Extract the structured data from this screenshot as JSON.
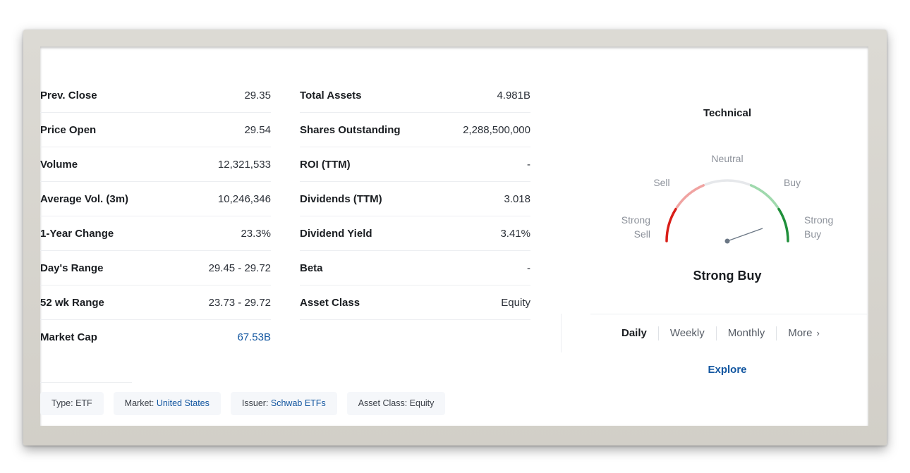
{
  "left_stats": [
    {
      "label": "Prev. Close",
      "value": "29.35"
    },
    {
      "label": "Price Open",
      "value": "29.54"
    },
    {
      "label": "Volume",
      "value": "12,321,533"
    },
    {
      "label": "Average Vol. (3m)",
      "value": "10,246,346"
    },
    {
      "label": "1-Year Change",
      "value": "23.3%"
    },
    {
      "label": "Day's Range",
      "value": "29.45 - 29.72"
    },
    {
      "label": "52 wk Range",
      "value": "23.73 - 29.72"
    },
    {
      "label": "Market Cap",
      "value": "67.53B"
    }
  ],
  "mid_stats": [
    {
      "label": "Total Assets",
      "value": "4.981B"
    },
    {
      "label": "Shares Outstanding",
      "value": "2,288,500,000"
    },
    {
      "label": "ROI (TTM)",
      "value": "-"
    },
    {
      "label": "Dividends (TTM)",
      "value": "3.018"
    },
    {
      "label": "Dividend Yield",
      "value": "3.41%"
    },
    {
      "label": "Beta",
      "value": "-"
    },
    {
      "label": "Asset Class",
      "value": "Equity"
    }
  ],
  "tags": [
    {
      "key": "Type:",
      "value": "ETF"
    },
    {
      "key": "Market:",
      "value": "United States"
    },
    {
      "key": "Issuer:",
      "value": "Schwab ETFs"
    },
    {
      "key": "Asset Class:",
      "value": "Equity"
    }
  ],
  "technical": {
    "title": "Technical",
    "labels": {
      "neutral": "Neutral",
      "sell": "Sell",
      "buy": "Buy",
      "strong_sell_1": "Strong",
      "strong_sell_2": "Sell",
      "strong_buy_1": "Strong",
      "strong_buy_2": "Buy"
    },
    "result": "Strong Buy",
    "periods": [
      "Daily",
      "Weekly",
      "Monthly",
      "More"
    ],
    "active_period": "Daily",
    "explore": "Explore",
    "colors": {
      "strong_sell": "#d91e18",
      "sell": "#f0a3a1",
      "neutral": "#e6e8eb",
      "buy": "#9fd9ad",
      "strong_buy": "#1f8f3a",
      "needle": "#6b7785"
    }
  }
}
